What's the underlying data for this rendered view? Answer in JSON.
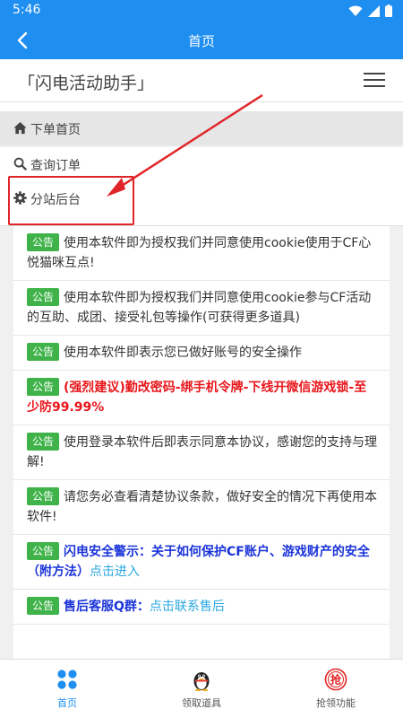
{
  "status_bar": {
    "time": "5:46"
  },
  "app_bar": {
    "title": "首页"
  },
  "header": {
    "brand": "「闪电活动助手」"
  },
  "nav": {
    "home": "下单首页",
    "query": "查询订单",
    "substation": "分站后台"
  },
  "notices": [
    {
      "badge": "公告",
      "text": "使用本软件即为授权我们并同意使用cookie使用于CF心悦猫咪互点!"
    },
    {
      "badge": "公告",
      "text": "使用本软件即为授权我们并同意使用cookie参与CF活动的互助、成团、接受礼包等操作(可获得更多道具)"
    },
    {
      "badge": "公告",
      "text": "使用本软件即表示您已做好账号的安全操作"
    },
    {
      "badge": "公告",
      "text": "(强烈建议)勤改密码-绑手机令牌-下线开微信游戏锁-至少防99.99%"
    },
    {
      "badge": "公告",
      "text": "使用登录本软件后即表示同意本协议，感谢您的支持与理解!"
    },
    {
      "badge": "公告",
      "text": "请您务必查看清楚协议条款，做好安全的情况下再使用本软件!"
    },
    {
      "badge": "公告",
      "text": "闪电安全警示：关于如何保护CF账户、游戏财产的安全（附方法）",
      "link": "点击进入"
    },
    {
      "badge": "公告",
      "text": "售后客服Q群：",
      "link": "点击联系售后"
    }
  ],
  "bottom_tabs": [
    {
      "label": "首页",
      "icon": "grid-dots-icon"
    },
    {
      "label": "领取道具",
      "icon": "penguin-icon"
    },
    {
      "label": "抢领功能",
      "icon": "grab-badge-icon"
    }
  ],
  "colors": {
    "primary": "#1e8ef0",
    "badge_green": "#3fb349",
    "alert_red": "#e8161b",
    "notice_blue": "#1a33d9",
    "link_cyan": "#2aa8e0",
    "annotation_red": "#e0252a"
  }
}
